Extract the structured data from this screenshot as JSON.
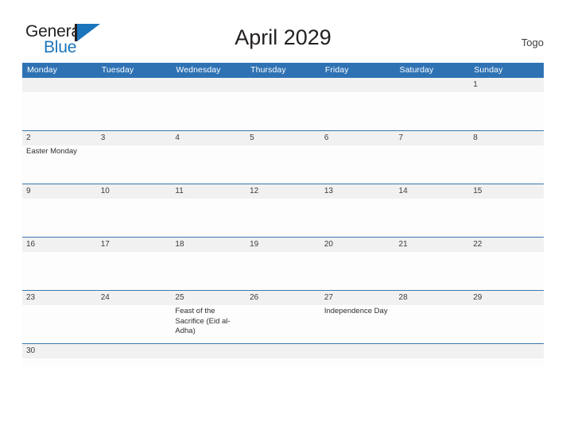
{
  "brand": {
    "name_part1": "General",
    "name_part2": "Blue",
    "flag_icon": "flag-icon"
  },
  "header": {
    "title": "April 2029",
    "country": "Togo"
  },
  "colors": {
    "header_blue": "#2e72b4",
    "brand_blue": "#1b75bc",
    "row_band": "#f1f1f1",
    "rule_blue": "#3a79ad",
    "text_dark": "#231f20"
  },
  "calendar": {
    "weekdays": [
      "Monday",
      "Tuesday",
      "Wednesday",
      "Thursday",
      "Friday",
      "Saturday",
      "Sunday"
    ],
    "weeks": [
      {
        "days": [
          {
            "num": "",
            "events": []
          },
          {
            "num": "",
            "events": []
          },
          {
            "num": "",
            "events": []
          },
          {
            "num": "",
            "events": []
          },
          {
            "num": "",
            "events": []
          },
          {
            "num": "",
            "events": []
          },
          {
            "num": "1",
            "events": []
          }
        ]
      },
      {
        "days": [
          {
            "num": "2",
            "events": [
              "Easter Monday"
            ]
          },
          {
            "num": "3",
            "events": []
          },
          {
            "num": "4",
            "events": []
          },
          {
            "num": "5",
            "events": []
          },
          {
            "num": "6",
            "events": []
          },
          {
            "num": "7",
            "events": []
          },
          {
            "num": "8",
            "events": []
          }
        ]
      },
      {
        "days": [
          {
            "num": "9",
            "events": []
          },
          {
            "num": "10",
            "events": []
          },
          {
            "num": "11",
            "events": []
          },
          {
            "num": "12",
            "events": []
          },
          {
            "num": "13",
            "events": []
          },
          {
            "num": "14",
            "events": []
          },
          {
            "num": "15",
            "events": []
          }
        ]
      },
      {
        "days": [
          {
            "num": "16",
            "events": []
          },
          {
            "num": "17",
            "events": []
          },
          {
            "num": "18",
            "events": []
          },
          {
            "num": "19",
            "events": []
          },
          {
            "num": "20",
            "events": []
          },
          {
            "num": "21",
            "events": []
          },
          {
            "num": "22",
            "events": []
          }
        ]
      },
      {
        "days": [
          {
            "num": "23",
            "events": []
          },
          {
            "num": "24",
            "events": []
          },
          {
            "num": "25",
            "events": [
              "Feast of the Sacrifice (Eid al-Adha)"
            ]
          },
          {
            "num": "26",
            "events": []
          },
          {
            "num": "27",
            "events": [
              "Independence Day"
            ]
          },
          {
            "num": "28",
            "events": []
          },
          {
            "num": "29",
            "events": []
          }
        ]
      },
      {
        "last": true,
        "days": [
          {
            "num": "30",
            "events": []
          },
          {
            "num": "",
            "events": []
          },
          {
            "num": "",
            "events": []
          },
          {
            "num": "",
            "events": []
          },
          {
            "num": "",
            "events": []
          },
          {
            "num": "",
            "events": []
          },
          {
            "num": "",
            "events": []
          }
        ]
      }
    ]
  }
}
